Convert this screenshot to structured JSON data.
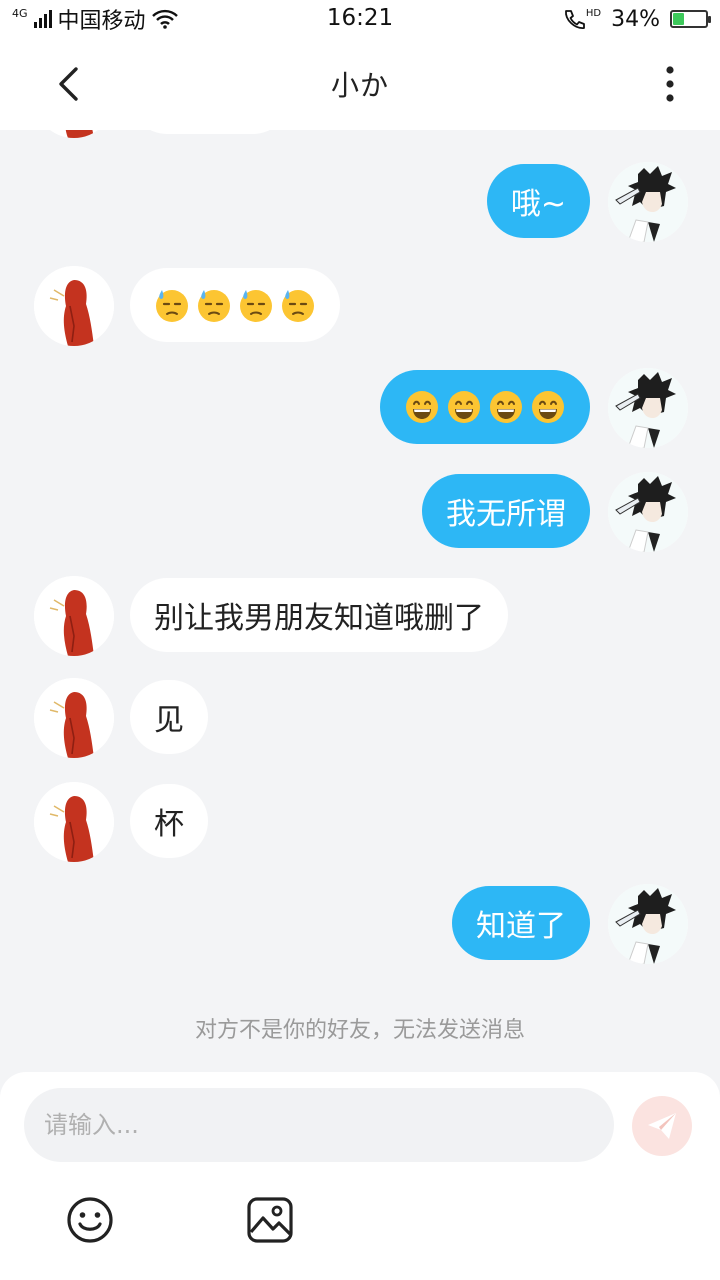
{
  "status_bar": {
    "network": "4G",
    "carrier": "中国移动",
    "time": "16:21",
    "hd_label": "HD",
    "battery": "34%",
    "battery_level": 0.34,
    "battery_color": "#3cc85a"
  },
  "header": {
    "title": "小か",
    "back_icon": "chevron-left-icon",
    "more_icon": "more-vertical-icon"
  },
  "colors": {
    "accent": "#2db7f5",
    "background": "#f3f4f6",
    "incoming_bubble": "#ffffff"
  },
  "messages": [
    {
      "direction": "out",
      "text": "哦~"
    },
    {
      "direction": "in",
      "emojis": [
        "downcast-sweat-face",
        "downcast-sweat-face",
        "downcast-sweat-face",
        "downcast-sweat-face"
      ]
    },
    {
      "direction": "out",
      "emojis": [
        "grinning-face",
        "grinning-face",
        "grinning-face",
        "grinning-face"
      ]
    },
    {
      "direction": "out",
      "text": "我无所谓"
    },
    {
      "direction": "in",
      "text": "别让我男朋友知道哦删了"
    },
    {
      "direction": "in",
      "text": "见"
    },
    {
      "direction": "in",
      "text": "杯"
    },
    {
      "direction": "out",
      "text": "知道了"
    }
  ],
  "notice": "对方不是你的好友，无法发送消息",
  "composer": {
    "placeholder": "请输入...",
    "send_icon": "send-icon",
    "emoji_icon": "smiley-icon",
    "image_icon": "image-icon"
  }
}
